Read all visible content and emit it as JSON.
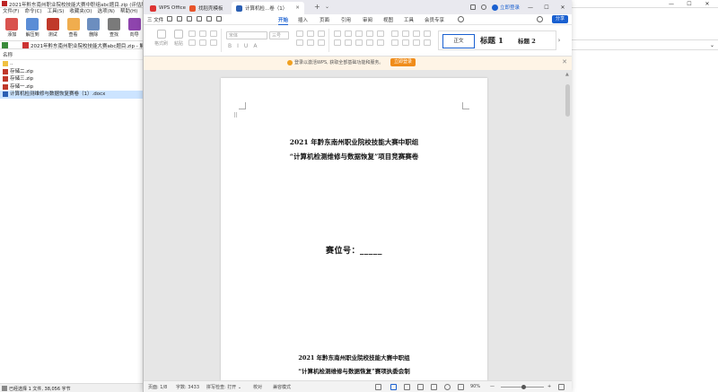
{
  "archiver": {
    "title": "2021年黔东南州职业院校技能大赛中职组abc题目.zip (评估版本)",
    "window_buttons": [
      "—",
      "☐",
      "✕"
    ],
    "menu": [
      "文件(F)",
      "命令(C)",
      "工具(S)",
      "收藏夹(O)",
      "选项(N)",
      "帮助(H)"
    ],
    "toolbar": [
      {
        "label": "添加",
        "color": "#d9534f"
      },
      {
        "label": "解压到",
        "color": "#5b8dd6"
      },
      {
        "label": "测试",
        "color": "#c0392b"
      },
      {
        "label": "查看",
        "color": "#f0ad4e"
      },
      {
        "label": "删除",
        "color": "#6c8ebf"
      },
      {
        "label": "查找",
        "color": "#7a7a7a"
      },
      {
        "label": "向导",
        "color": "#8e44ad"
      }
    ],
    "path": "2021年黔东南州职业院校技能大赛abc题目.zip - 解包大小为",
    "column_header": "名称",
    "files": [
      {
        "name": "..",
        "color": "#f0c040"
      },
      {
        "name": "存储二.zip",
        "color": "#c0392b"
      },
      {
        "name": "存储三.zip",
        "color": "#c0392b"
      },
      {
        "name": "存储一.zip",
        "color": "#c0392b"
      },
      {
        "name": "计算机检测维修与数据恢复赛卷（1）.docx",
        "color": "#2b5fb3"
      }
    ],
    "status": "已经选择 1 文件, 38,056 字节",
    "right_chevron": "⌄"
  },
  "wps": {
    "tabs": [
      {
        "label": "WPS Office",
        "color": "#d33"
      },
      {
        "label": "找稻壳模板",
        "color": "#e8542b"
      },
      {
        "label": "计算机检...卷（1）",
        "color": "#2b5fb3"
      }
    ],
    "tab_close": "✕",
    "tab_add": "+",
    "tab_more": "⌄",
    "login": "立即登录",
    "window_buttons": [
      "—",
      "☐",
      "✕"
    ],
    "file_menu": "三 文件",
    "ribbon_tabs": [
      "开始",
      "插入",
      "页面",
      "引用",
      "审阅",
      "视图",
      "工具",
      "会员专享"
    ],
    "active_ribbon_tab": "开始",
    "share": "分享",
    "tools": {
      "format_painter": "格式刷",
      "paste": "粘贴",
      "font_name": "宋体",
      "font_size": "三号",
      "format_buttons": [
        "B",
        "I",
        "U",
        "A"
      ],
      "style_body": "正文",
      "style_h1": "标题 1",
      "style_h2": "标题 2",
      "style_arrow": "›"
    },
    "notice": {
      "text": "登录以激活WPS, 获取全部基础功能和服务。",
      "button": "立即登录",
      "close": "✕"
    },
    "document": {
      "title_line1": "2021 年黔东南州职业院校技能大赛中职组",
      "title_line2": "“计算机检测维修与数据恢复”项目竞赛赛卷",
      "seat_line": "赛位号：_____",
      "footer_line1": "2021 年黔东南州职业院校技能大赛中职组",
      "footer_line2": "“计算机检测维修与数据恢复”赛项执委会制",
      "grip": "⠿"
    },
    "status": {
      "page": "页面: 1/8",
      "words": "字数: 3433",
      "spell": "拼写检查: 打开 ⌄",
      "proof": "校对",
      "compat": "兼容模式",
      "zoom": "90%",
      "zoom_minus": "—",
      "zoom_plus": "+"
    }
  }
}
